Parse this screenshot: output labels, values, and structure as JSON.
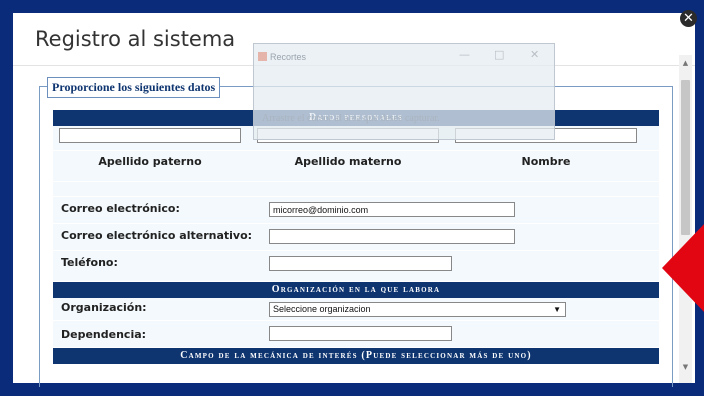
{
  "dialog": {
    "title": "Registro al sistema",
    "close_glyph": "✕"
  },
  "snipping_tool": {
    "title": "Recortes",
    "minimize": "—",
    "maximize": "□",
    "close": "✕",
    "hint": "Arrastre el cursor al área que desee capturar."
  },
  "form": {
    "legend": "Proporcione los siguientes datos",
    "personal_section": "Datos personales",
    "apellido_paterno": "Apellido paterno",
    "apellido_materno": "Apellido materno",
    "nombre": "Nombre",
    "email_label": "Correo electrónico:",
    "email_value": "micorreo@dominio.com",
    "alt_email_label": "Correo electrónico alternativo:",
    "phone_label": "Teléfono:",
    "org_section": "Organización en la que labora",
    "org_label": "Organización:",
    "org_selected": "Seleccione organizacion",
    "dependencia_label": "Dependencia:",
    "interest_section": "Campo de la mecánica de interés (Puede seleccionar más de uno)"
  },
  "scrollbar": {
    "up": "▲",
    "down": "▼"
  },
  "colors": {
    "header": "#0f3570",
    "annotation_arrow": "#e20613",
    "background": "#0a2a7a"
  }
}
